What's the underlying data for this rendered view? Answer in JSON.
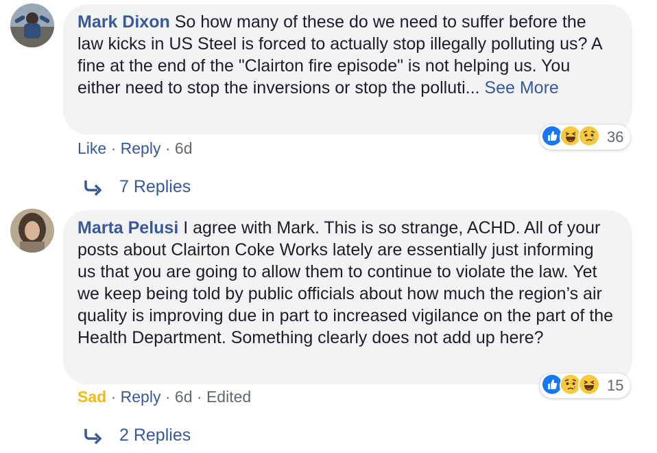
{
  "comments": [
    {
      "author": "Mark Dixon",
      "text": " So how many of these do we need to suffer before the law kicks in US Steel is forced to actually stop illegally polluting us? A fine at the end of the \"Clairton fire episode\" is not helping us. You either need to stop the inversions or stop the polluti... ",
      "see_more": "See More",
      "like": "Like",
      "reply": "Reply",
      "time": "6d",
      "reactions": [
        "like-icon",
        "haha-icon",
        "sad-icon"
      ],
      "reaction_count": "36",
      "replies": "7 Replies"
    },
    {
      "author": "Marta Pelusi",
      "text": " I agree with Mark. This is so strange, ACHD. All of your posts about Clairton Coke Works lately are essentially just informing us that you are going to allow them to continue to violate the law. Yet we keep being told by public officials about how much the region’s air quality is improving due in part to increased vigilance on the part of the Health Department. Something clearly does not add up here?",
      "reaction_label": "Sad",
      "reply": "Reply",
      "time": "6d",
      "edited": "Edited",
      "reactions": [
        "like-icon",
        "sad-icon",
        "haha-icon"
      ],
      "reaction_count": "15",
      "replies": "2 Replies"
    }
  ],
  "colors": {
    "link": "#385898",
    "meta": "#606770",
    "bubble": "#f2f3f5",
    "sad": "#f0ba15",
    "like_blue": "#1877f2",
    "emoji_yellow": "#f7c93e"
  },
  "separator": "·"
}
